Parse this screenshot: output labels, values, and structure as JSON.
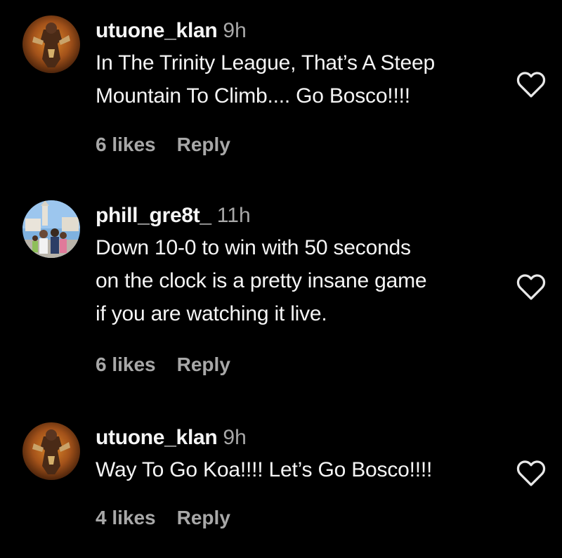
{
  "colors": {
    "background": "#000000",
    "primary_text": "#f5f5f5",
    "secondary_text": "#a8a8a8"
  },
  "comments": [
    {
      "username": "utuone_klan",
      "time": "9h",
      "lines": [
        "In The Trinity League, That’s A Steep",
        "Mountain To Climb.... Go Bosco!!!!"
      ],
      "likes": "6 likes",
      "reply": "Reply",
      "like_icon": "heart-outline-icon"
    },
    {
      "username": "phill_gre8t_",
      "time": "11h",
      "lines": [
        "Down 10-0 to win with 50 seconds",
        "on the clock is a pretty insane game",
        "if you are watching it live."
      ],
      "likes": "6 likes",
      "reply": "Reply",
      "like_icon": "heart-outline-icon"
    },
    {
      "username": "utuone_klan",
      "time": "9h",
      "lines": [
        "Way To Go Koa!!!! Let’s Go Bosco!!!!"
      ],
      "likes": "4 likes",
      "reply": "Reply",
      "like_icon": "heart-outline-icon"
    }
  ]
}
